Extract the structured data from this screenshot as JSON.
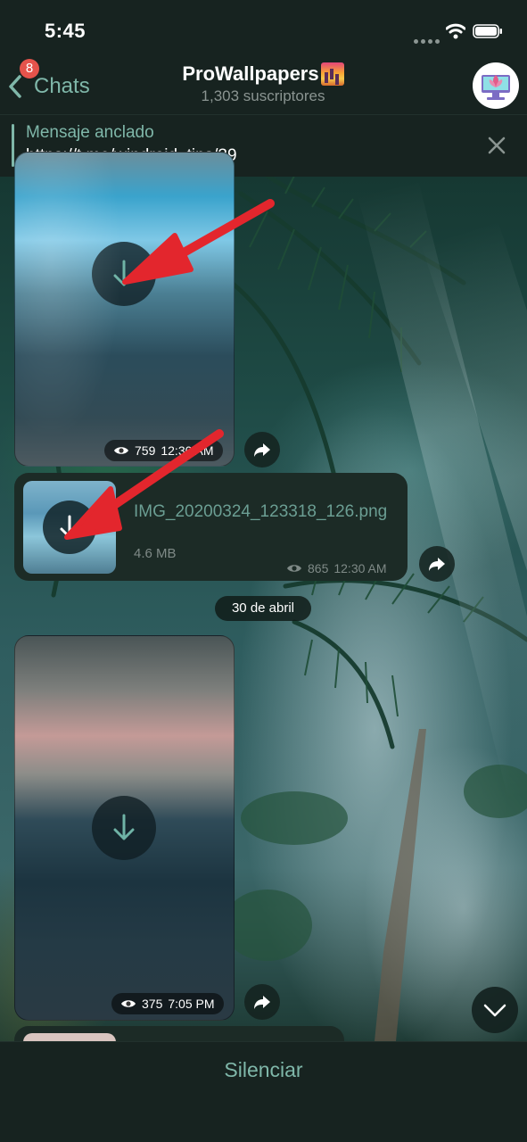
{
  "status_bar": {
    "time": "5:45"
  },
  "header": {
    "back_label": "Chats",
    "unread_badge": "8",
    "title": "ProWallpapers",
    "subtitle": "1,303 suscriptores",
    "avatar_icon": "computer-plant-icon"
  },
  "pinned": {
    "label": "Mensaje anclado",
    "text": "https://t.me/windroid_tips/39"
  },
  "messages": [
    {
      "type": "photo",
      "views": "759",
      "time": "12:30 AM"
    },
    {
      "type": "file",
      "filename": "IMG_20200324_123318_126.png",
      "size": "4.6 MB",
      "views": "865",
      "time": "12:30 AM"
    },
    {
      "type": "photo",
      "views": "375",
      "time": "7:05 PM"
    }
  ],
  "date_separator": "30 de abril",
  "bottom": {
    "mute_label": "Silenciar"
  },
  "colors": {
    "accent": "#7fb7a9",
    "badge": "#e5534b",
    "annotation_arrow": "#e3262d"
  }
}
